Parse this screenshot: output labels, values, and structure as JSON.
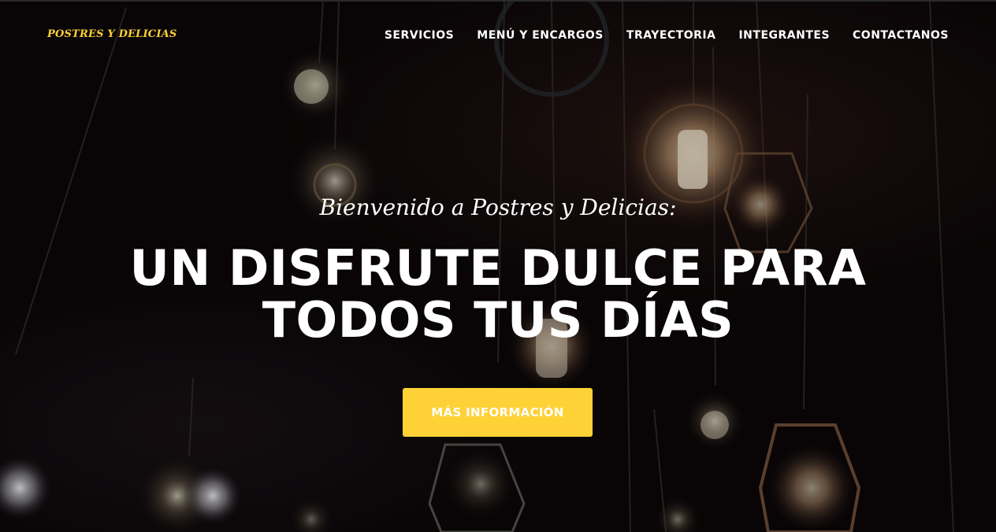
{
  "brand": {
    "name": "POSTRES Y DELICIAS",
    "color": "#fed136"
  },
  "nav": {
    "items": [
      {
        "label": "SERVICIOS"
      },
      {
        "label": "MENÚ Y ENCARGOS"
      },
      {
        "label": "TRAYECTORIA"
      },
      {
        "label": "INTEGRANTES"
      },
      {
        "label": "CONTACTANOS"
      }
    ]
  },
  "hero": {
    "lead": "Bienvenido a Postres y Delicias:",
    "heading": "UN DISFRUTE DULCE PARA TODOS TUS DÍAS",
    "cta_label": "MÁS INFORMACIÓN",
    "cta_color": "#fed136",
    "background": "hanging-light-bulbs-photo"
  }
}
